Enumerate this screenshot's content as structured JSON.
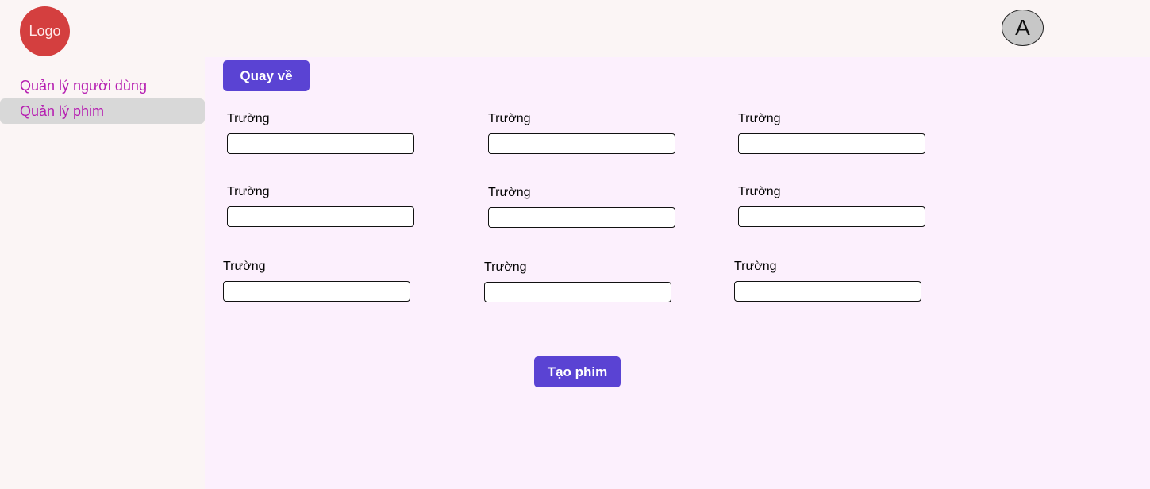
{
  "header": {
    "logo_text": "Logo",
    "avatar_letter": "A"
  },
  "sidebar": {
    "items": [
      {
        "label": "Quản lý người dùng",
        "active": false
      },
      {
        "label": "Quản lý phim",
        "active": true
      }
    ]
  },
  "main": {
    "back_label": "Quay về",
    "create_label": "Tạo phim",
    "fields": [
      {
        "label": "Trường",
        "value": "",
        "placeholder": ""
      },
      {
        "label": "Trường",
        "value": "",
        "placeholder": ""
      },
      {
        "label": "Trường",
        "value": "",
        "placeholder": ""
      },
      {
        "label": "Trường",
        "value": "",
        "placeholder": ""
      },
      {
        "label": "Trường",
        "value": "",
        "placeholder": ""
      },
      {
        "label": "Trường",
        "value": "",
        "placeholder": ""
      },
      {
        "label": "Trường",
        "value": "",
        "placeholder": ""
      },
      {
        "label": "Trường",
        "value": "",
        "placeholder": ""
      },
      {
        "label": "Trường",
        "value": "",
        "placeholder": ""
      }
    ]
  },
  "colors": {
    "logo": "#d43f3f",
    "accent_button": "#5a43d3",
    "sidebar_text": "#b61fb1",
    "main_background": "#fcf0fd",
    "page_background": "#fbf5f5",
    "active_item_background": "#d8d8d8",
    "avatar_background": "#c7c7c7"
  }
}
